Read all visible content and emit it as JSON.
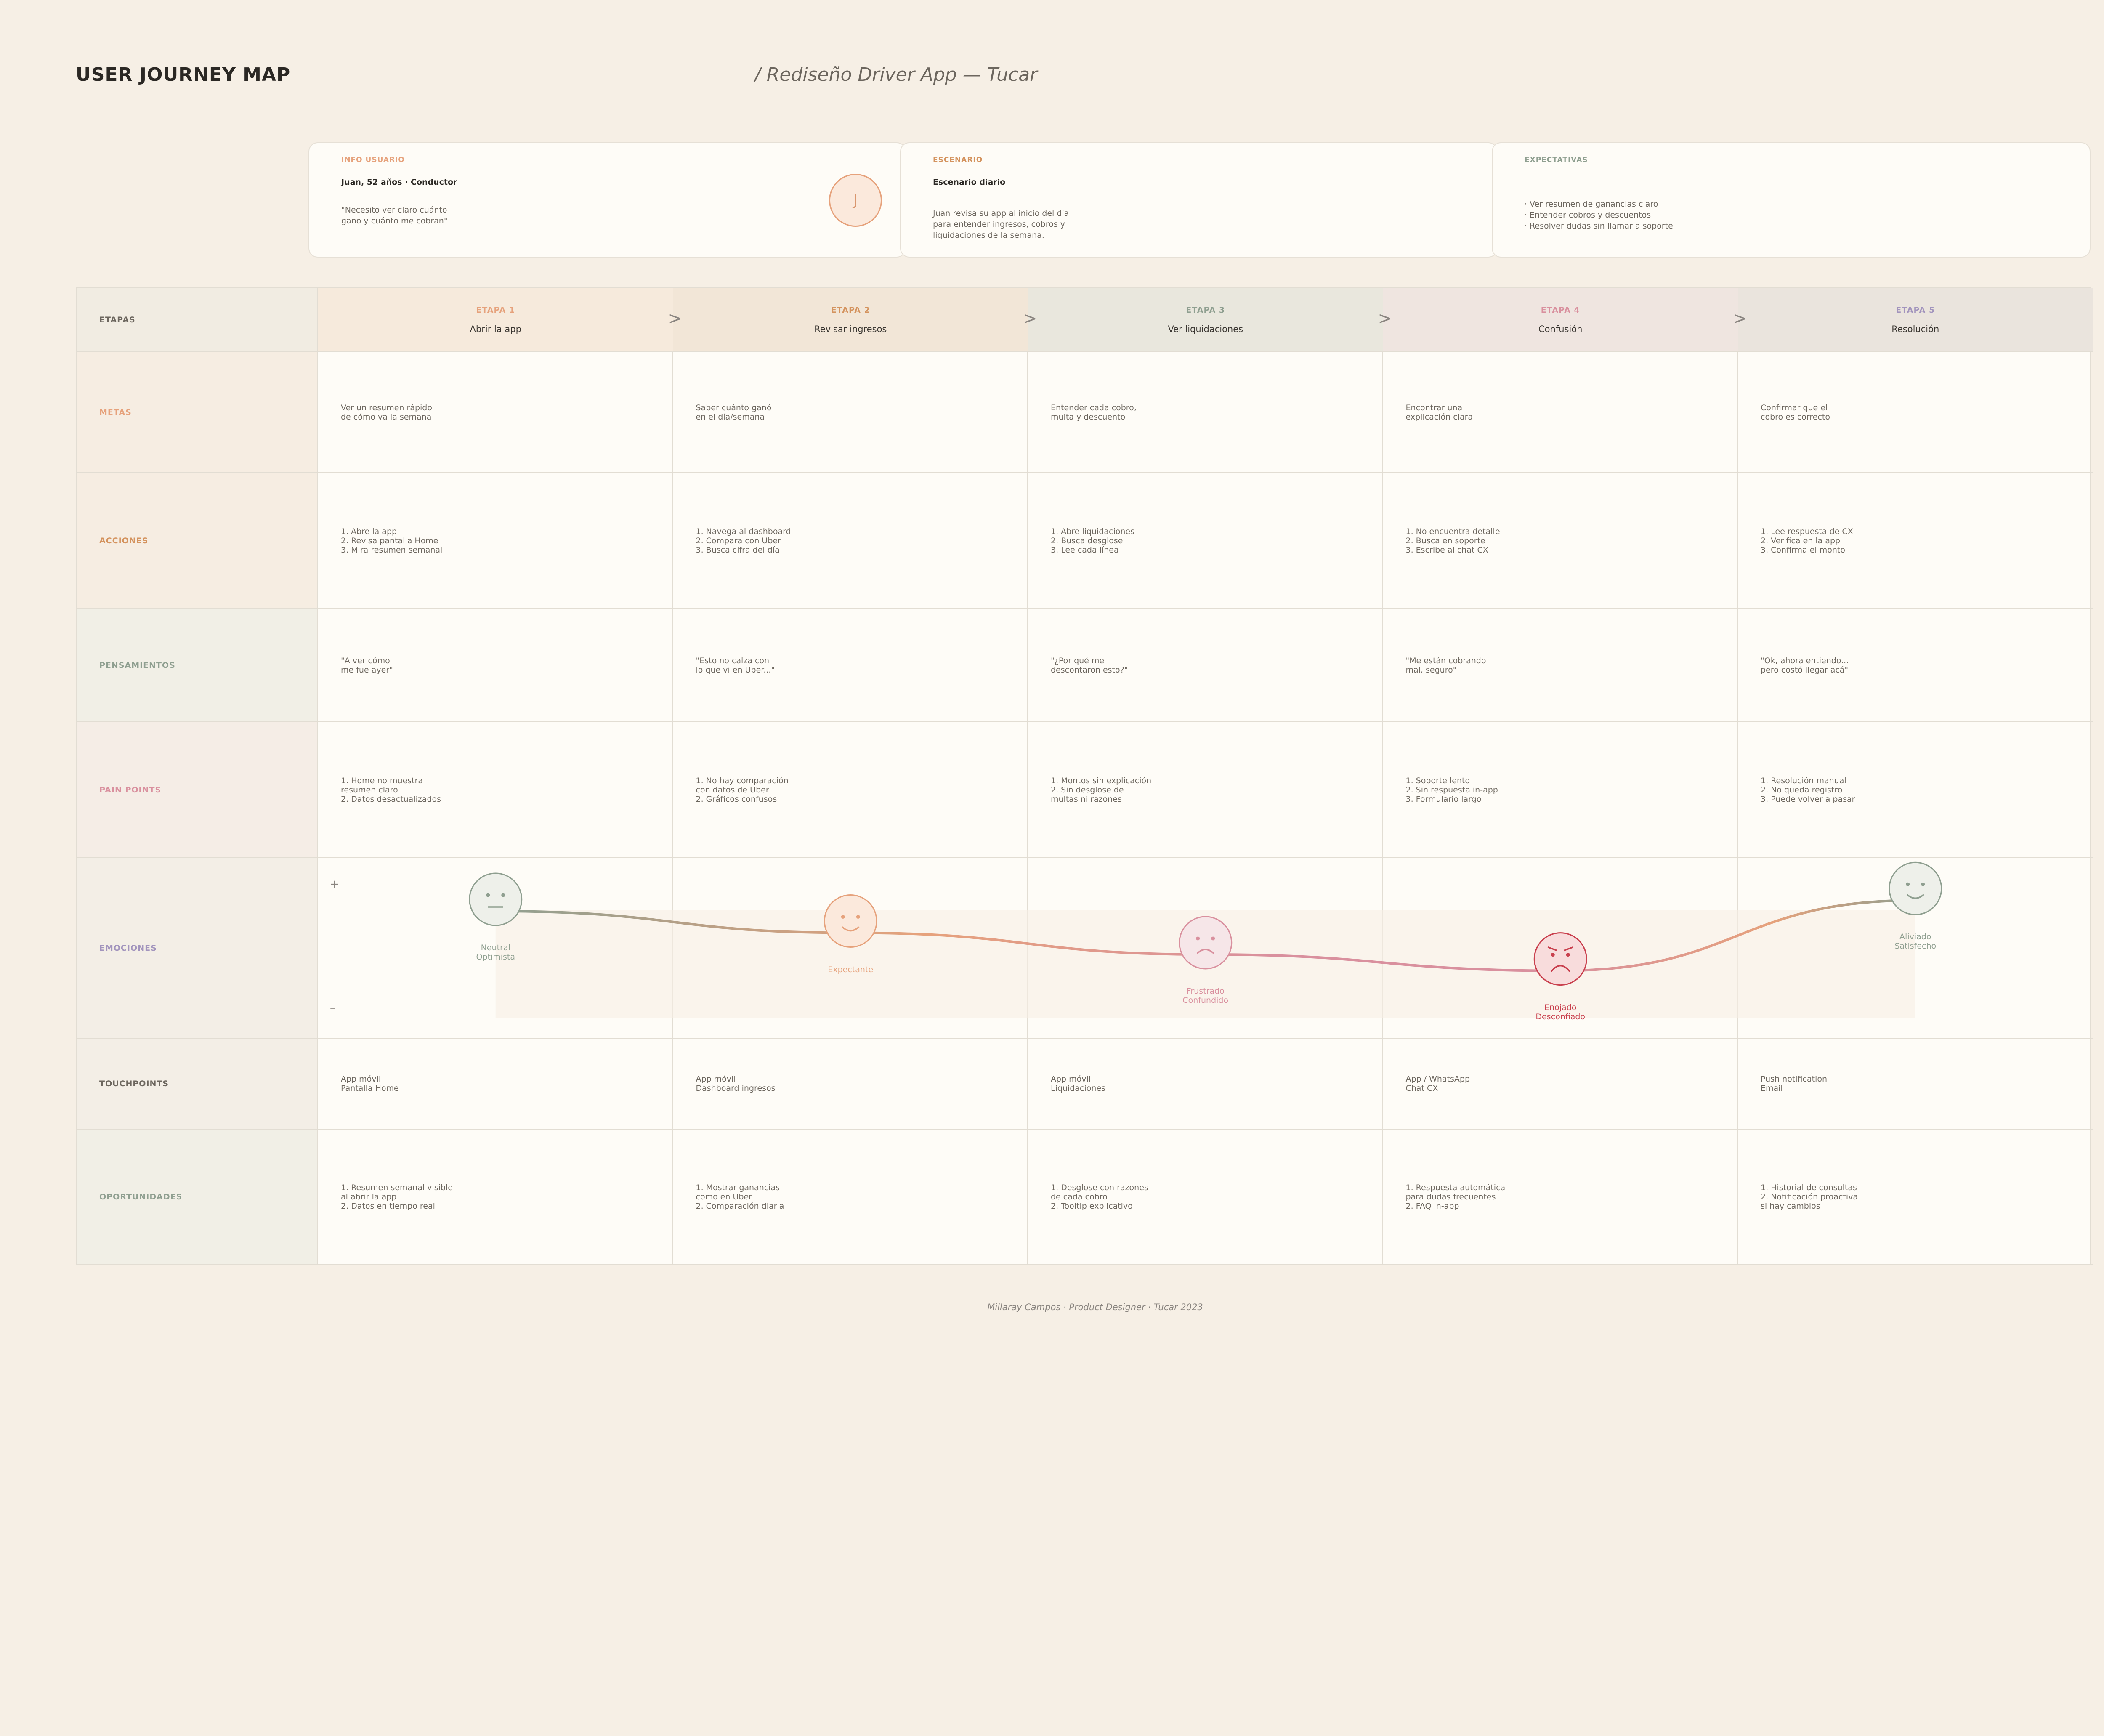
{
  "header": {
    "title": "USER JOURNEY MAP",
    "subtitle": "/ Rediseño Driver App — Tucar"
  },
  "cards": [
    {
      "label": "INFO USUARIO",
      "title": "Juan, 52 años · Conductor",
      "text": "\"Necesito ver claro cuánto\ngano y cuánto me cobran\"",
      "label_color": "#e6a27c"
    },
    {
      "label": "ESCENARIO",
      "title": "Escenario diario",
      "text": "Juan revisa su app al inicio del día\npara entender ingresos, cobros y\nliquidaciones de la semana.",
      "label_color": "#d4935e"
    },
    {
      "label": "EXPECTATIVAS",
      "title": "",
      "text": "· Ver resumen de ganancias claro\n· Entender cobros y descuentos\n· Resolver dudas sin llamar a soporte",
      "label_color": "#8f9f90"
    }
  ],
  "avatar": {
    "initial": "J"
  },
  "row_labels": [
    {
      "key": "etapas",
      "label": "ETAPAS",
      "color": "#6c665e",
      "bg": "#f1ece2"
    },
    {
      "key": "metas",
      "label": "METAS",
      "color": "#e6a27c",
      "bg": "#f6ede2"
    },
    {
      "key": "acciones",
      "label": "ACCIONES",
      "color": "#d4935e",
      "bg": "#f6ede2"
    },
    {
      "key": "pensamientos",
      "label": "PENSAMIENTOS",
      "color": "#8f9f90",
      "bg": "#f1efe6"
    },
    {
      "key": "pain_points",
      "label": "PAIN POINTS",
      "color": "#d9909e",
      "bg": "#f5ede6"
    },
    {
      "key": "emociones",
      "label": "EMOCIONES",
      "color": "#a294bd",
      "bg": "#f3eee6"
    },
    {
      "key": "touchpoints",
      "label": "TOUCHPOINTS",
      "color": "#6c665e",
      "bg": "#f3eee6"
    },
    {
      "key": "oportunidades",
      "label": "OPORTUNIDADES",
      "color": "#8f9f90",
      "bg": "#f1efe6"
    }
  ],
  "stages": [
    {
      "num": "ETAPA 1",
      "name": "Abrir la app",
      "num_color": "#e6a27c",
      "bg": "#f6eadc",
      "metas": "Ver un resumen rápido\nde cómo va la semana",
      "acciones": "1. Abre la app\n2. Revisa pantalla Home\n3. Mira resumen semanal",
      "pensamientos": "\"A ver cómo\nme fue ayer\"",
      "pain_points": "1. Home no muestra\n   resumen claro\n2. Datos desactualizados",
      "touchpoints": "App móvil\nPantalla Home",
      "oportunidades": "1. Resumen semanal visible\n   al abrir la app\n2. Datos en tiempo real"
    },
    {
      "num": "ETAPA 2",
      "name": "Revisar ingresos",
      "num_color": "#d4935e",
      "bg": "#f2e6d7",
      "metas": "Saber cuánto ganó\nen el día/semana",
      "acciones": "1. Navega al dashboard\n2. Compara con Uber\n3. Busca cifra del día",
      "pensamientos": "\"Esto no calza con\nlo que vi en Uber...\"",
      "pain_points": "1. No hay comparación\n   con datos de Uber\n2. Gráficos confusos",
      "touchpoints": "App móvil\nDashboard ingresos",
      "oportunidades": "1. Mostrar ganancias\n   como en Uber\n2. Comparación diaria"
    },
    {
      "num": "ETAPA 3",
      "name": "Ver liquidaciones",
      "num_color": "#8f9f90",
      "bg": "#e9e7dd",
      "metas": "Entender cada cobro,\nmulta y descuento",
      "acciones": "1. Abre liquidaciones\n2. Busca desglose\n3. Lee cada línea",
      "pensamientos": "\"¿Por qué me\ndescontaron esto?\"",
      "pain_points": "1. Montos sin explicación\n2. Sin desglose de\n   multas ni razones",
      "touchpoints": "App móvil\nLiquidaciones",
      "oportunidades": "1. Desglose con razones\n   de cada cobro\n2. Tooltip explicativo"
    },
    {
      "num": "ETAPA 4",
      "name": "Confusión",
      "num_color": "#d9909e",
      "bg": "#efe5e0",
      "metas": "Encontrar una\nexplicación clara",
      "acciones": "1. No encuentra detalle\n2. Busca en soporte\n3. Escribe al chat CX",
      "pensamientos": "\"Me están cobrando\nmal, seguro\"",
      "pain_points": "1. Soporte lento\n2. Sin respuesta in-app\n3. Formulario largo",
      "touchpoints": "App / WhatsApp\nChat CX",
      "oportunidades": "1. Respuesta automática\n   para dudas frecuentes\n2. FAQ in-app"
    },
    {
      "num": "ETAPA 5",
      "name": "Resolución",
      "num_color": "#a294bd",
      "bg": "#eae4dd",
      "metas": "Confirmar que el\ncobro es correcto",
      "acciones": "1. Lee respuesta de CX\n2. Verifica en la app\n3. Confirma el monto",
      "pensamientos": "\"Ok, ahora entiendo...\npero costó llegar acá\"",
      "pain_points": "1. Resolución manual\n2. No queda registro\n3. Puede volver a pasar",
      "touchpoints": "Push notification\nEmail",
      "oportunidades": "1. Historial de consultas\n2. Notificación proactiva\n   si hay cambios"
    }
  ],
  "emotion_axis": {
    "plus": "+",
    "minus": "–"
  },
  "emotions": [
    {
      "label": "Neutral\nOptimista",
      "level": 0.62,
      "color": "#8f9f90",
      "face": "neutral"
    },
    {
      "label": "Expectante",
      "level": 0.5,
      "color": "#e6a27c",
      "face": "smile"
    },
    {
      "label": "Frustrado\nConfundido",
      "level": 0.38,
      "color": "#d9909e",
      "face": "sad"
    },
    {
      "label": "Enojado\nDesconfiado",
      "level": 0.29,
      "color": "#c9404e",
      "face": "angry"
    },
    {
      "label": "Aliviado\nSatisfecho",
      "level": 0.68,
      "color": "#8f9f90",
      "face": "smile"
    }
  ],
  "footer": "Millaray Campos · Product Designer · Tucar 2023"
}
